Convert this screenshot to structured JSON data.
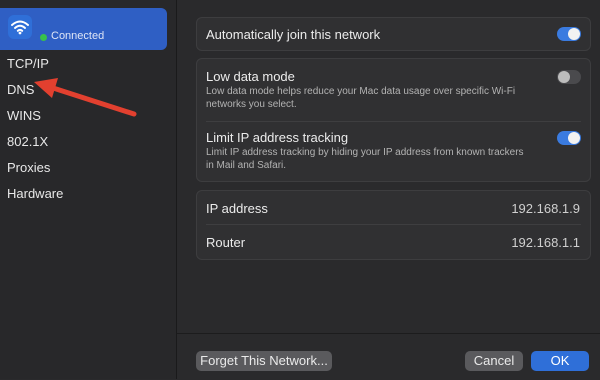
{
  "sidebar": {
    "status": "Connected",
    "items": [
      "TCP/IP",
      "DNS",
      "WINS",
      "802.1X",
      "Proxies",
      "Hardware"
    ]
  },
  "settings": {
    "auto_join": {
      "label": "Automatically join this network",
      "on": true
    },
    "low_data": {
      "label": "Low data mode",
      "desc": "Low data mode helps reduce your Mac data usage over specific Wi-Fi networks you select.",
      "on": false
    },
    "limit_ip": {
      "label": "Limit IP address tracking",
      "desc": "Limit IP address tracking by hiding your IP address from known trackers in Mail and Safari.",
      "on": true
    }
  },
  "network": {
    "ip_label": "IP address",
    "ip_value": "192.168.1.9",
    "router_label": "Router",
    "router_value": "192.168.1.1"
  },
  "buttons": {
    "forget": "Forget This Network...",
    "cancel": "Cancel",
    "ok": "OK"
  },
  "colors": {
    "accent": "#2f6fd8",
    "annotation_arrow": "#e2402f",
    "connected": "#38c24a"
  },
  "icons": {
    "wifi": "wifi-icon",
    "arrow": "annotation-arrow"
  }
}
